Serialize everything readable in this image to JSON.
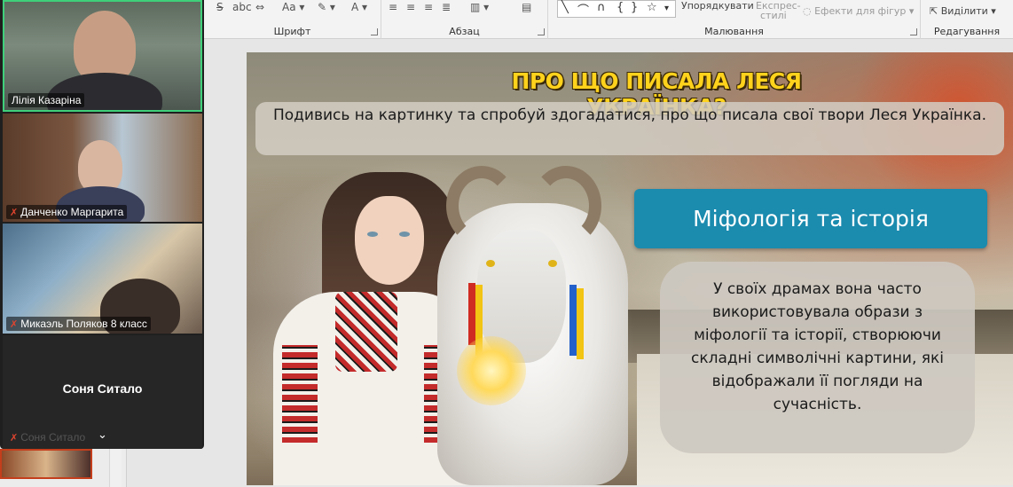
{
  "ribbon": {
    "groups": [
      {
        "label": "Шрифт"
      },
      {
        "label": "Абзац"
      },
      {
        "label": "Малювання"
      },
      {
        "label": "Редагування"
      }
    ],
    "arrange_label": "Упорядкувати",
    "express_label": "Експрес-",
    "styles_label": "стилі",
    "effects_label": "Ефекти для фігур",
    "select_label": "Виділити",
    "icons": [
      "strikethrough-icon",
      "text-shadow-icon",
      "char-spacing-icon",
      "change-case-icon",
      "highlight-icon",
      "font-color-icon",
      "align-left-icon",
      "align-center-icon",
      "align-right-icon",
      "justify-icon",
      "columns-icon",
      "shapes-gallery",
      "cursor-icon"
    ]
  },
  "video": {
    "participants": [
      {
        "name": "Лілія Казаріна",
        "muted": false
      },
      {
        "name": "Данченко Маргарита",
        "muted": true
      },
      {
        "name": "Микаэль Поляков 8 класс",
        "muted": true
      },
      {
        "name": "Соня Ситало",
        "muted": true
      }
    ],
    "active_speaker_color": "#3fd07a"
  },
  "slide": {
    "title": "ПРО ЩО ПИСАЛА ЛЕСЯ УКРАЇНКА?",
    "subtitle": "Подивись на картинку та спробуй здогадатися, про що писала свої твори Леся Українка.",
    "topic": "Міфологія та історія",
    "description": "У своїх драмах вона часто використовувала образи з міфології та історії, створюючи складні символічні картини, які відображали її погляди на сучасність.",
    "colors": {
      "title": "#ffd21c",
      "topic_bg": "#1b8bae"
    }
  }
}
